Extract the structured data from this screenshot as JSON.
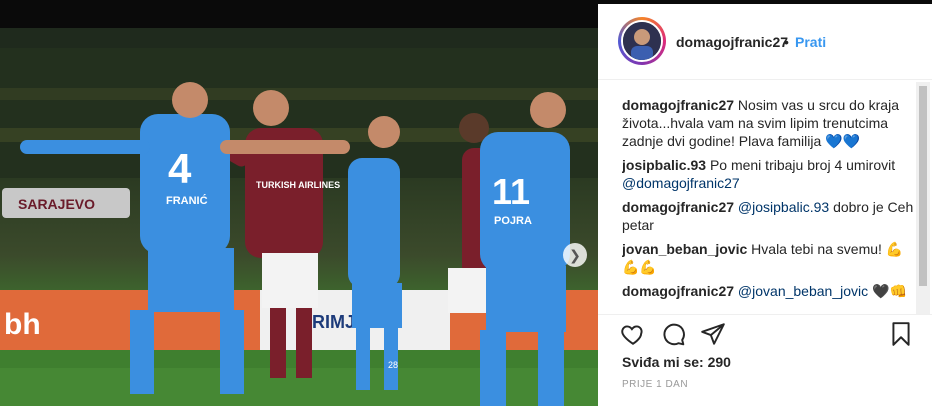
{
  "post": {
    "username": "domagojfranic27",
    "separator": "•",
    "follow_label": "Prati",
    "likes_text": "Sviđa mi se: 290",
    "timestamp": "PRIJE 1 DAN"
  },
  "photo": {
    "jersey_4_number": "4",
    "jersey_4_name": "FRANIĆ",
    "jersey_11_number": "11",
    "jersey_11_name": "POJRA",
    "sponsor_maroon": "TURKISH AIRLINES",
    "stadium_sign": "SARAJEVO",
    "board_left": "bh",
    "board_mid": "PRIMJE",
    "player_28": "28"
  },
  "comments": [
    {
      "user": "domagojfranic27",
      "text": "Nosim vas u srcu do kraja života...hvala vam na svim lipim trenutcima zadnje dvi godine! Plava familija",
      "emoji": "💙💙"
    },
    {
      "user": "josipbalic.93",
      "text": "Po meni tribaju broj 4 umirovit",
      "mention": "@domagojfranic27"
    },
    {
      "user": "domagojfranic27",
      "mention": "@josipbalic.93",
      "text": "dobro je Ceh petar"
    },
    {
      "user": "jovan_beban_jovic",
      "text": "Hvala tebi na svemu!",
      "emoji": "💪💪💪"
    },
    {
      "user": "domagojfranic27",
      "mention": "@jovan_beban_jovic",
      "emoji": "🖤👊"
    }
  ],
  "icons": [
    "heart-icon",
    "comment-icon",
    "share-icon",
    "bookmark-icon",
    "chevron-right-icon"
  ],
  "colors": {
    "accent_link": "#3897f0",
    "mention": "#003569",
    "jersey_blue": "#3b8fe0",
    "jersey_maroon": "#7a1f2b"
  }
}
